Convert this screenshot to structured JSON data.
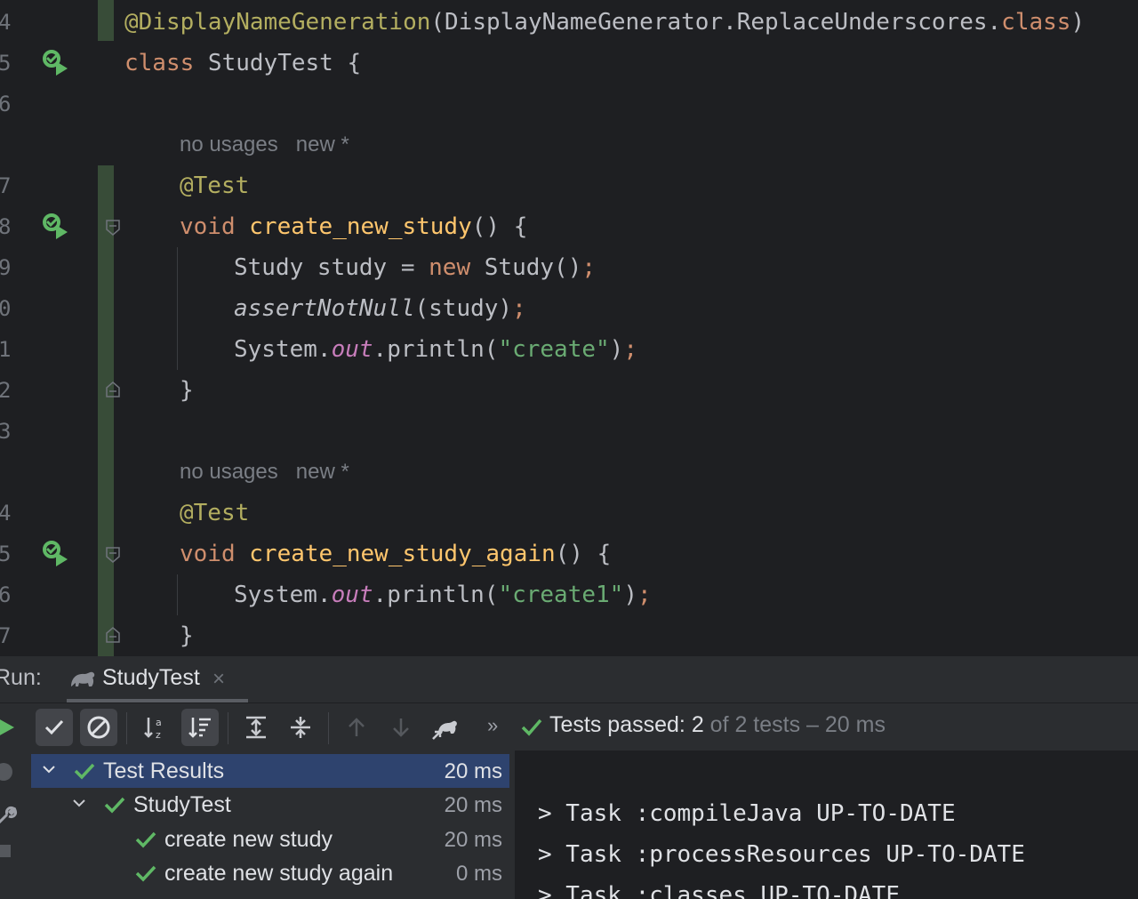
{
  "editor": {
    "line_numbers": [
      "4",
      "5",
      "6",
      "7",
      "8",
      "9",
      "0",
      "1",
      "2",
      "3",
      "4",
      "5",
      "6",
      "7"
    ],
    "hints": {
      "usages": "no usages",
      "author": "new *"
    },
    "tokens": {
      "ann_display": "@DisplayNameGeneration",
      "display_args": "(DisplayNameGenerator.ReplaceUnderscores.",
      "kw_class": "class",
      "paren_close": ")",
      "class_decl_name": " StudyTest {",
      "ann_test": "@Test",
      "kw_void": "void",
      "m1_name": "create_new_study",
      "m_tail": "() {",
      "l9_a": "Study study = ",
      "kw_new": "new",
      "l9_b": " Study()",
      "semi": ";",
      "assert": "assertNotNull",
      "assert_args": "(study)",
      "sys": "System.",
      "out": "out",
      "println": ".println(",
      "str1": "\"create\"",
      "str2": "\"create1\"",
      "close_paren": ")",
      "brace": "}",
      "m2_name": "create_new_study_again"
    }
  },
  "run_panel": {
    "label": "Run:",
    "tab": {
      "title": "StudyTest",
      "close": "×"
    },
    "toolbar": {
      "buttons": [
        "show-passed",
        "show-ignored",
        "sort-alpha",
        "sort-duration",
        "expand-all",
        "collapse-all",
        "prev-failed",
        "next-failed",
        "import-tests"
      ],
      "more": "»"
    },
    "status": {
      "prefix": "Tests passed: ",
      "count": "2",
      "suffix": " of 2 tests – 20 ms"
    },
    "tree": [
      {
        "label": "Test Results",
        "time": "20 ms"
      },
      {
        "label": "StudyTest",
        "time": "20 ms"
      },
      {
        "label": "create new study",
        "time": "20 ms"
      },
      {
        "label": "create new study again",
        "time": "0 ms"
      }
    ],
    "console": [
      "> Task :compileJava UP-TO-DATE",
      "> Task :processResources UP-TO-DATE",
      "> Task :classes UP-TO-DATE"
    ]
  },
  "colors": {
    "editor_bg": "#1e1f22",
    "panel_bg": "#2b2d30",
    "selection": "#2e436e",
    "pass_green": "#5fb865",
    "keyword": "#cf8e6d",
    "annotation": "#b3ae60",
    "string": "#6aab73",
    "method_decl": "#ffc66d"
  },
  "icons": [
    "run-test-icon",
    "fold-icon",
    "gradle-icon",
    "close-icon",
    "check-icon",
    "ban-icon",
    "sort-alpha-icon",
    "sort-duration-icon",
    "expand-all-icon",
    "collapse-all-icon",
    "arrow-up-icon",
    "arrow-down-icon",
    "import-icon",
    "chevron-down-icon",
    "play-icon",
    "wrench-icon",
    "stop-icon"
  ]
}
